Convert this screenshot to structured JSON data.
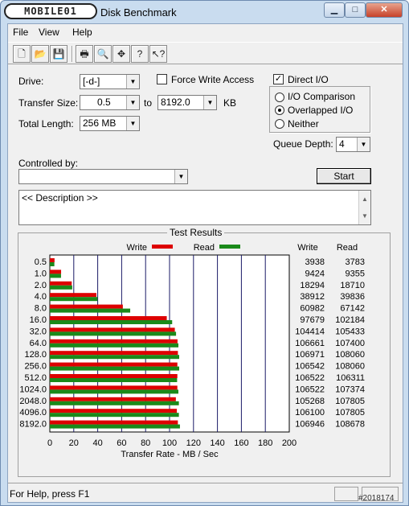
{
  "window": {
    "title": "Disk Benchmark",
    "logo_text": "MOBILE01",
    "caption_buttons": {
      "minimize": "▁",
      "maximize": "□",
      "close": "✕"
    }
  },
  "menu": [
    "File",
    "View",
    "Help"
  ],
  "toolbar_icons": [
    "new-icon",
    "open-icon",
    "save-icon",
    "print-icon",
    "print-preview-icon",
    "move-icon",
    "help-icon",
    "context-help-icon"
  ],
  "settings": {
    "drive_label": "Drive:",
    "drive_value": "[-d-]",
    "force_write_label": "Force Write Access",
    "force_write_checked": false,
    "transfer_size_label": "Transfer Size:",
    "transfer_from": "0.5",
    "to_label": "to",
    "transfer_to": "8192.0",
    "kb_label": "KB",
    "total_length_label": "Total Length:",
    "total_length_value": "256 MB",
    "direct_io_label": "Direct I/O",
    "direct_io_checked": true,
    "io_options": [
      {
        "label": "I/O Comparison",
        "selected": false
      },
      {
        "label": "Overlapped I/O",
        "selected": true
      },
      {
        "label": "Neither",
        "selected": false
      }
    ],
    "queue_depth_label": "Queue Depth:",
    "queue_depth_value": "4",
    "controlled_by_label": "Controlled by:",
    "controlled_by_value": "",
    "start_label": "Start",
    "description": "<< Description >>"
  },
  "results": {
    "title": "Test Results",
    "legend_write": "Write",
    "legend_read": "Read",
    "col_write": "Write",
    "col_read": "Read",
    "write_color": "#dd0000",
    "read_color": "#1a8a1a"
  },
  "chart_data": {
    "type": "bar",
    "xlabel": "Transfer Rate - MB / Sec",
    "xlim": [
      0,
      200
    ],
    "xticks": [
      "0",
      "20",
      "40",
      "60",
      "80",
      "100",
      "120",
      "140",
      "160",
      "180",
      "200"
    ],
    "categories": [
      "0.5",
      "1.0",
      "2.0",
      "4.0",
      "8.0",
      "16.0",
      "32.0",
      "64.0",
      "128.0",
      "256.0",
      "512.0",
      "1024.0",
      "2048.0",
      "4096.0",
      "8192.0"
    ],
    "series": [
      {
        "name": "Write",
        "values": [
          3938,
          9424,
          18294,
          38912,
          60982,
          97679,
          104414,
          106661,
          106971,
          106542,
          106522,
          106522,
          105268,
          106100,
          106946
        ]
      },
      {
        "name": "Read",
        "values": [
          3783,
          9355,
          18710,
          39836,
          67142,
          102184,
          105433,
          107400,
          108060,
          108060,
          106311,
          107374,
          107805,
          107805,
          108678
        ]
      }
    ]
  },
  "status": {
    "text": "For Help, press F1",
    "watermark": "#2018174"
  }
}
